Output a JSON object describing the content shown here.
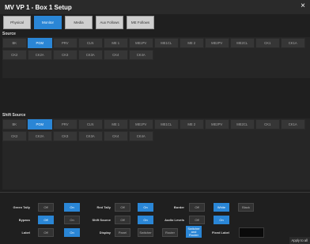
{
  "window": {
    "title": "MV VP 1 - Box 1 Setup",
    "close_label": "×"
  },
  "tabs": [
    {
      "label": "Physical",
      "active": false
    },
    {
      "label": "Monitor",
      "active": true
    },
    {
      "label": "Media",
      "active": false
    },
    {
      "label": "Aux Follows",
      "active": false
    },
    {
      "label": "ME Follows",
      "active": false
    }
  ],
  "source": {
    "label": "Source",
    "row1": [
      "BK",
      "PGM",
      "PRV",
      "CLN",
      "ME 1",
      "ME1PV",
      "ME1CL",
      "ME 2",
      "ME2PV",
      "ME2CL",
      "CK1",
      "CK1A"
    ],
    "row2": [
      "CK2",
      "CK2A",
      "CK3",
      "CK3A",
      "CK4",
      "CK4A"
    ],
    "selected": "PGM"
  },
  "shift_source": {
    "label": "Shift Source",
    "row1": [
      "BK",
      "PGM",
      "PRV",
      "CLN",
      "ME 1",
      "ME1PV",
      "ME1CL",
      "ME 2",
      "ME2PV",
      "ME2CL",
      "CK1",
      "CK1A"
    ],
    "row2": [
      "CK2",
      "CK2A",
      "CK3",
      "CK3A",
      "CK4",
      "CK4A"
    ],
    "selected": "PGM"
  },
  "controls": {
    "green_tally": {
      "label": "Green Tally",
      "off": "Off",
      "on": "On",
      "value": "On"
    },
    "red_tally": {
      "label": "Red Tally",
      "off": "Off",
      "on": "On",
      "value": "On"
    },
    "border": {
      "label": "Border",
      "off": "Off",
      "white": "White",
      "black": "Black",
      "value": "White"
    },
    "bypass": {
      "label": "Bypass",
      "off": "Off",
      "on": "On",
      "value": "Off"
    },
    "shift_source": {
      "label": "Shift Source",
      "off": "Off",
      "on": "On",
      "value": "On"
    },
    "audio_levels": {
      "label": "Audio Levels",
      "off": "Off",
      "on": "On",
      "value": "On"
    },
    "label": {
      "label": "Label",
      "off": "Off",
      "on": "On",
      "value": "On"
    },
    "display": {
      "label": "Display",
      "options": [
        "Panel",
        "Switcher",
        "Router",
        "Switcher and Router"
      ],
      "value": "Switcher and Router"
    },
    "fixed_label": {
      "label": "Fixed Label"
    }
  },
  "apply_label": "Apply to all"
}
